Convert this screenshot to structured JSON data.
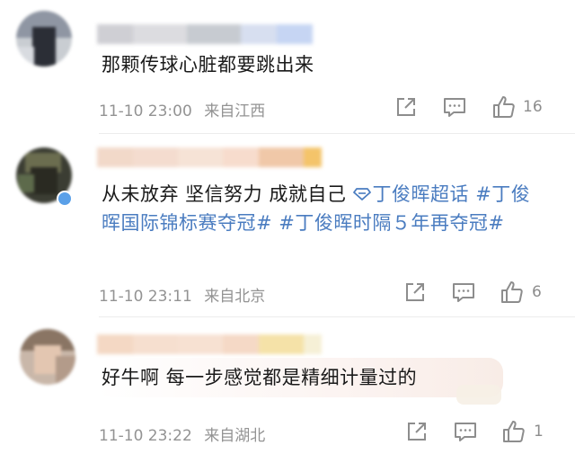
{
  "comments": [
    {
      "text": "那颗传球心脏都要跳出来",
      "time": "11-10 23:00",
      "location": "来自江西",
      "like_count": "16"
    },
    {
      "text_plain": "从未放弃 坚信努力 成就自己 ",
      "topic_super": "丁俊晖超话",
      "topic_hash_1": " #丁俊晖国际锦标赛夺冠# ",
      "topic_hash_2": "#丁俊晖时隔５年再夺冠#",
      "time": "11-10 23:11",
      "location": "来自北京",
      "like_count": "6"
    },
    {
      "text": "好牛啊 每一步感觉都是精细计量过的",
      "time": "11-10 23:22",
      "location": "来自湖北",
      "like_count": "1"
    }
  ],
  "colors": {
    "text": "#1a1a1a",
    "meta": "#939393",
    "topic": "#4a7cc0"
  },
  "icons": [
    "share-icon",
    "comment-icon",
    "like-icon",
    "diamond-topic-icon"
  ]
}
